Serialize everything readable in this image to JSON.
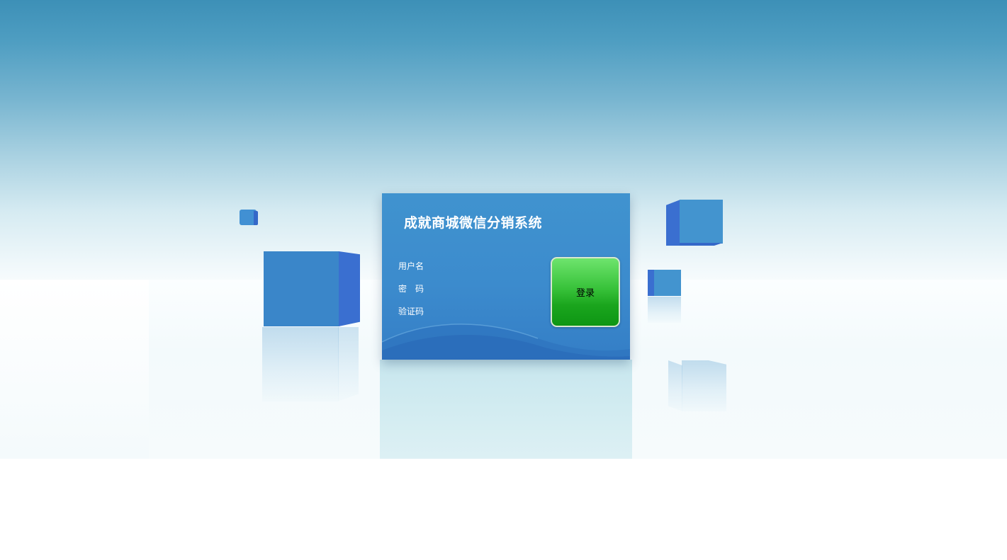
{
  "login": {
    "title": "成就商城微信分销系统",
    "username_label": "用户名",
    "password_label": "密　码",
    "captcha_label": "验证码",
    "username_value": "",
    "password_value": "",
    "captcha_value": "",
    "submit_label": "登录"
  },
  "colors": {
    "panel": "#3c8bcd",
    "cube_front": "#3a86c9",
    "cube_side": "#3a6fd0",
    "button_top": "#6ee46d",
    "button_bottom": "#0e9614",
    "sky_top": "#3d90b7"
  }
}
